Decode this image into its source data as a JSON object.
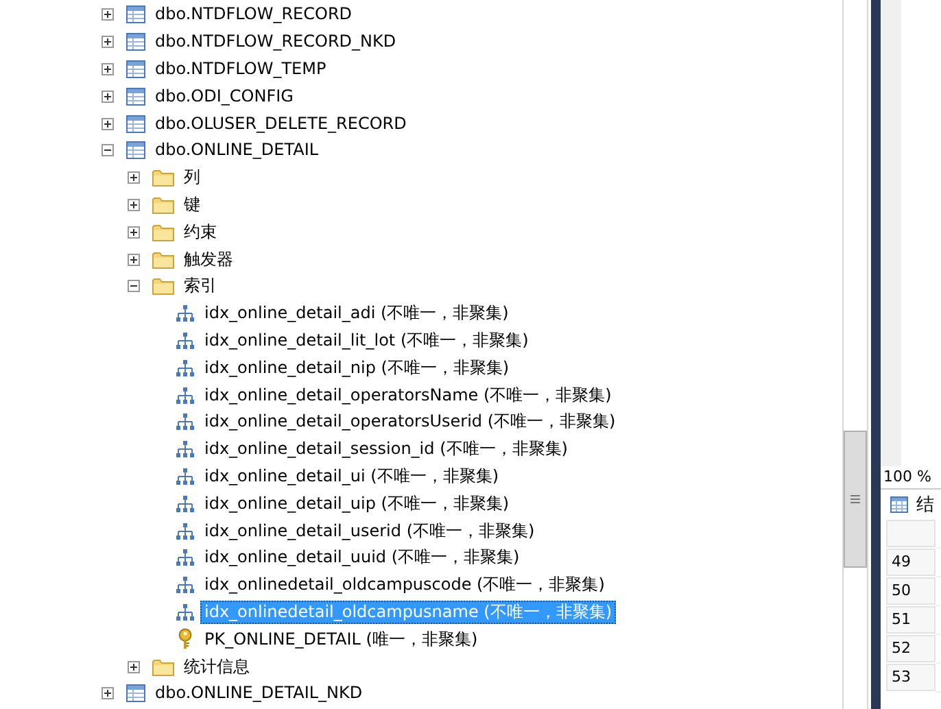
{
  "tree": [
    {
      "label": "dbo.NTDFLOW_RECORD",
      "expanded": false
    },
    {
      "label": "dbo.NTDFLOW_RECORD_NKD",
      "expanded": false
    },
    {
      "label": "dbo.NTDFLOW_TEMP",
      "expanded": false
    },
    {
      "label": "dbo.ODI_CONFIG",
      "expanded": false
    },
    {
      "label": "dbo.OLUSER_DELETE_RECORD",
      "expanded": false
    },
    {
      "label": "dbo.ONLINE_DETAIL",
      "expanded": true,
      "children": [
        {
          "label": "列",
          "expanded": false
        },
        {
          "label": "键",
          "expanded": false
        },
        {
          "label": "约束",
          "expanded": false
        },
        {
          "label": "触发器",
          "expanded": false
        },
        {
          "label": "索引",
          "expanded": true,
          "children": [
            {
              "kind": "index",
              "label": "idx_online_detail_adi (不唯一，非聚集)",
              "selected": false
            },
            {
              "kind": "index",
              "label": "idx_online_detail_lit_lot (不唯一，非聚集)",
              "selected": false
            },
            {
              "kind": "index",
              "label": "idx_online_detail_nip (不唯一，非聚集)",
              "selected": false
            },
            {
              "kind": "index",
              "label": "idx_online_detail_operatorsName (不唯一，非聚集)",
              "selected": false
            },
            {
              "kind": "index",
              "label": "idx_online_detail_operatorsUserid (不唯一，非聚集)",
              "selected": false
            },
            {
              "kind": "index",
              "label": "idx_online_detail_session_id (不唯一，非聚集)",
              "selected": false
            },
            {
              "kind": "index",
              "label": "idx_online_detail_ui (不唯一，非聚集)",
              "selected": false
            },
            {
              "kind": "index",
              "label": "idx_online_detail_uip (不唯一，非聚集)",
              "selected": false
            },
            {
              "kind": "index",
              "label": "idx_online_detail_userid (不唯一，非聚集)",
              "selected": false
            },
            {
              "kind": "index",
              "label": "idx_online_detail_uuid (不唯一，非聚集)",
              "selected": false
            },
            {
              "kind": "index",
              "label": "idx_onlinedetail_oldcampuscode (不唯一，非聚集)",
              "selected": false
            },
            {
              "kind": "index",
              "label": "idx_onlinedetail_oldcampusname (不唯一，非聚集)",
              "selected": true
            },
            {
              "kind": "key",
              "label": "PK_ONLINE_DETAIL (唯一，非聚集)",
              "selected": false
            }
          ]
        },
        {
          "label": "统计信息",
          "expanded": false
        }
      ]
    },
    {
      "label": "dbo.ONLINE_DETAIL_NKD",
      "expanded": false
    }
  ],
  "zoom": "100 %",
  "results_tab": "结",
  "row_numbers": [
    "49",
    "50",
    "51",
    "52",
    "53"
  ]
}
